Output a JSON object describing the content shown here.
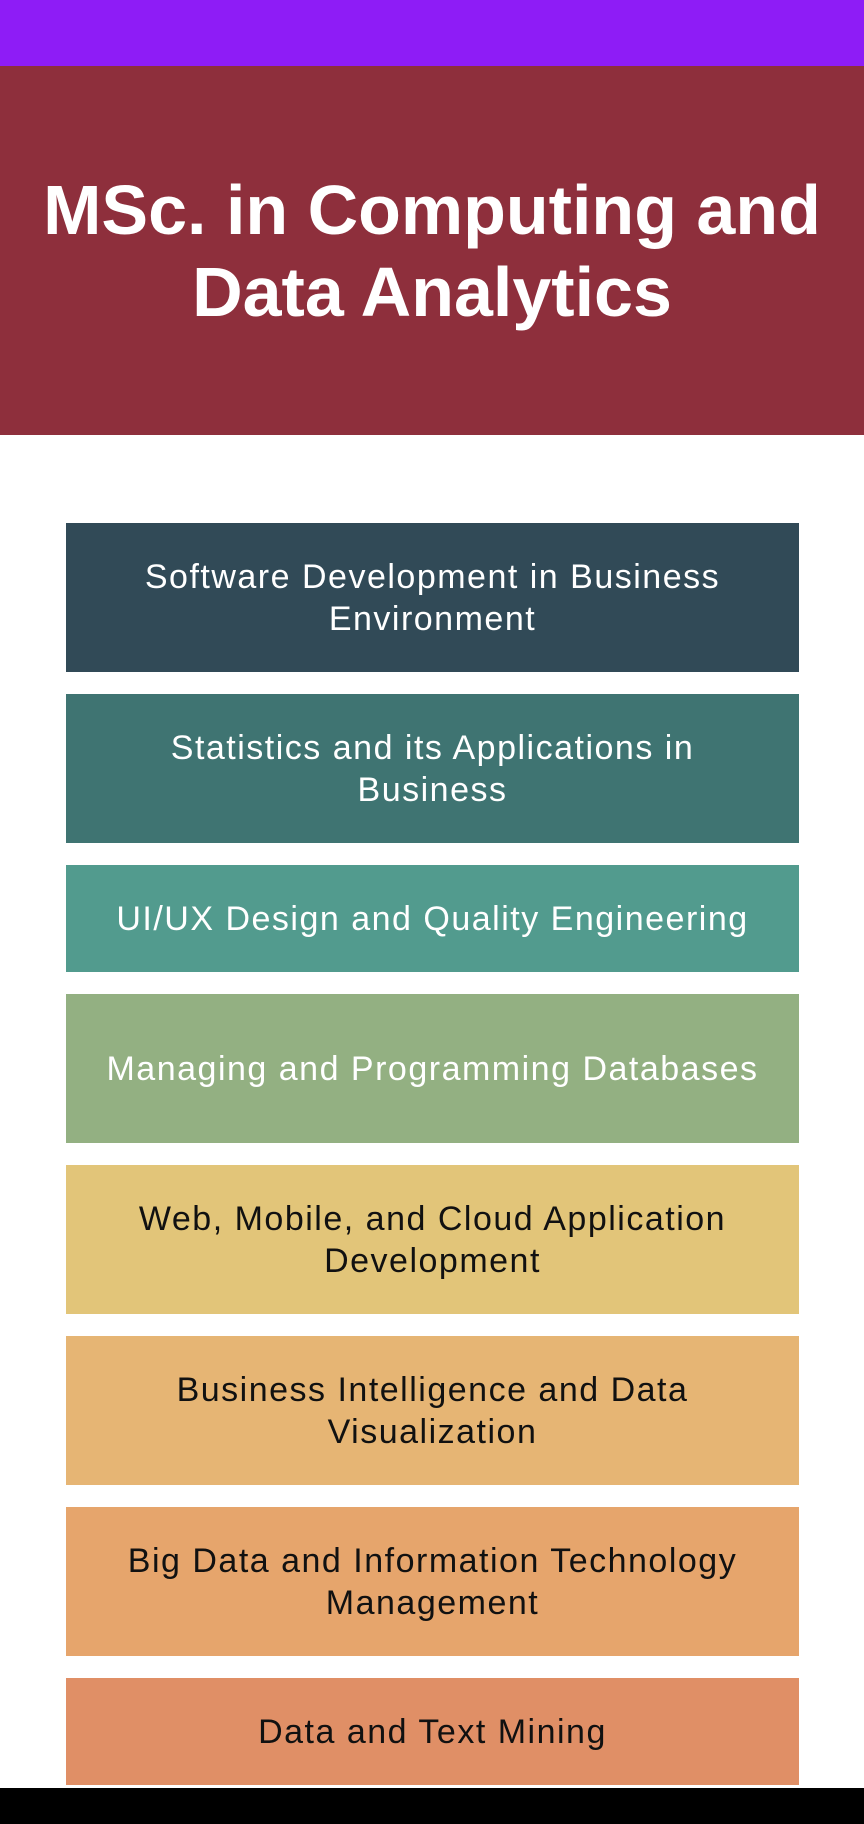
{
  "header": {
    "title": "MSc. in Computing and Data Analytics"
  },
  "courses": [
    {
      "label": "Software Development in Business Environment",
      "color": "#314a57",
      "text_color": "#ffffff"
    },
    {
      "label": "Statistics and its Applications in Business",
      "color": "#3f7472",
      "text_color": "#ffffff"
    },
    {
      "label": "UI/UX Design and Quality Engineering",
      "color": "#529b8e",
      "text_color": "#ffffff"
    },
    {
      "label": "Managing and Programming Databases",
      "color": "#93b082",
      "text_color": "#ffffff"
    },
    {
      "label": "Web, Mobile, and Cloud Application Development",
      "color": "#e2c579",
      "text_color": "#111111"
    },
    {
      "label": "Business Intelligence and Data Visualization",
      "color": "#e6b574",
      "text_color": "#111111"
    },
    {
      "label": "Big Data and Information Technology Management",
      "color": "#e6a56c",
      "text_color": "#111111"
    },
    {
      "label": "Data and Text Mining",
      "color": "#e08f66",
      "text_color": "#111111"
    }
  ],
  "colors": {
    "status_bar": "#8e1cf6",
    "header_background": "#8e2f3c",
    "nav_bar": "#000000"
  }
}
